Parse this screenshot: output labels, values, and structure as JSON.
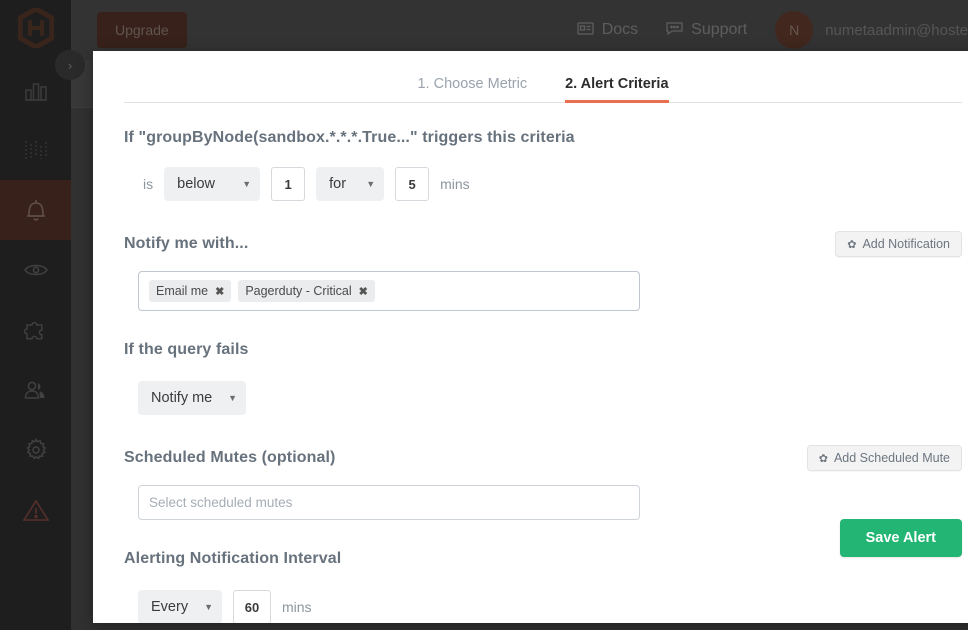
{
  "sidebar": {
    "logo_icon": "hexagon-h-logo",
    "items": [
      {
        "icon": "bar-chart-icon",
        "name": "dashboards",
        "active": false,
        "danger": false
      },
      {
        "icon": "metrics-icon",
        "name": "metrics",
        "active": false,
        "danger": false
      },
      {
        "icon": "bell-icon",
        "name": "alerts",
        "active": true,
        "danger": false
      },
      {
        "icon": "eye-icon",
        "name": "monitoring",
        "active": false,
        "danger": false
      },
      {
        "icon": "puzzle-icon",
        "name": "integrations",
        "active": false,
        "danger": false
      },
      {
        "icon": "users-icon",
        "name": "team",
        "active": false,
        "danger": false
      },
      {
        "icon": "gear-icon",
        "name": "settings",
        "active": false,
        "danger": false
      },
      {
        "icon": "warning-icon",
        "name": "incidents",
        "active": false,
        "danger": true
      }
    ],
    "collapse_caret": "›"
  },
  "topbar": {
    "upgrade_label": "Upgrade",
    "docs_label": "Docs",
    "support_label": "Support",
    "avatar_initial": "N",
    "user_email": "numetaadmin@hoste"
  },
  "modal": {
    "close_glyph": "×",
    "tabs": [
      {
        "label": "1. Choose Metric",
        "active": false
      },
      {
        "label": "2. Alert Criteria",
        "active": true
      }
    ],
    "criteria": {
      "heading": "If \"groupByNode(sandbox.*.*.*.True...\" triggers this criteria",
      "is_label": "is",
      "comparator": "below",
      "threshold": "1",
      "for_label": "for",
      "duration": "5",
      "mins_label": "mins",
      "caret": "▼"
    },
    "notify": {
      "heading": "Notify me with...",
      "add_button": "Add Notification",
      "gear_glyph": "✿",
      "tags": [
        {
          "label": "Email me",
          "remove": "✖"
        },
        {
          "label": "Pagerduty - Critical",
          "remove": "✖"
        }
      ]
    },
    "query_fails": {
      "heading": "If the query fails",
      "selected": "Notify me",
      "caret": "▼"
    },
    "scheduled_mutes": {
      "heading": "Scheduled Mutes (optional)",
      "add_button": "Add Scheduled Mute",
      "gear_glyph": "✿",
      "placeholder": "Select scheduled mutes",
      "value": ""
    },
    "interval": {
      "heading": "Alerting Notification Interval",
      "frequency": "Every",
      "minutes": "60",
      "mins_label": "mins",
      "caret": "▼"
    },
    "save_label": "Save Alert"
  },
  "colors": {
    "accent_orange": "#e8704f",
    "save_green": "#22b573",
    "brand_brown": "#4a2317",
    "sidebar_dark": "#1e1e1e"
  }
}
